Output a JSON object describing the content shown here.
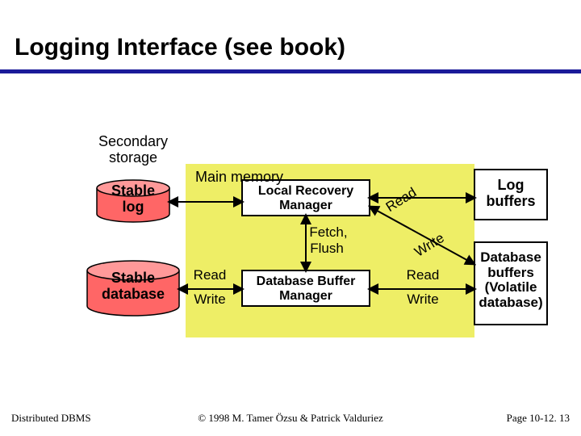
{
  "title": "Logging Interface (see book)",
  "labels": {
    "secondary_storage": "Secondary\nstorage",
    "main_memory": "Main memory",
    "stable_log": "Stable\nlog",
    "stable_db": "Stable\ndatabase",
    "lrm": "Local Recovery\nManager",
    "dbm": "Database Buffer\nManager",
    "fetch": "Fetch,",
    "flush": "Flush",
    "read_l": "Read",
    "write_l": "Write",
    "read_r": "Read",
    "write_r": "Write",
    "read_diag": "Read",
    "write_diag": "Write",
    "log_buffers": "Log\nbuffers",
    "db_buffers": "Database\nbuffers\n(Volatile\ndatabase)"
  },
  "footer": {
    "left": "Distributed DBMS",
    "center": "© 1998 M. Tamer Özsu & Patrick Valduriez",
    "right": "Page 10-12. 13"
  },
  "chart_data": {
    "type": "diagram",
    "title": "Logging Interface",
    "regions": [
      {
        "name": "Secondary storage",
        "contains": [
          "Stable log",
          "Stable database"
        ]
      },
      {
        "name": "Main memory",
        "contains": [
          "Local Recovery Manager",
          "Database Buffer Manager",
          "Log buffers",
          "Database buffers (Volatile database)"
        ]
      }
    ],
    "nodes": [
      {
        "id": "stable_log",
        "label": "Stable log",
        "type": "cylinder",
        "region": "Secondary storage"
      },
      {
        "id": "stable_db",
        "label": "Stable database",
        "type": "cylinder",
        "region": "Secondary storage"
      },
      {
        "id": "lrm",
        "label": "Local Recovery Manager",
        "type": "box",
        "region": "Main memory"
      },
      {
        "id": "dbm",
        "label": "Database Buffer Manager",
        "type": "box",
        "region": "Main memory"
      },
      {
        "id": "log_buf",
        "label": "Log buffers",
        "type": "box",
        "region": "Main memory"
      },
      {
        "id": "db_buf",
        "label": "Database buffers (Volatile database)",
        "type": "box",
        "region": "Main memory"
      }
    ],
    "edges": [
      {
        "from": "stable_log",
        "to": "lrm",
        "bidirectional": true,
        "labels": []
      },
      {
        "from": "stable_db",
        "to": "dbm",
        "bidirectional": true,
        "labels": [
          "Read",
          "Write"
        ]
      },
      {
        "from": "lrm",
        "to": "dbm",
        "bidirectional": true,
        "labels": [
          "Fetch,",
          "Flush"
        ]
      },
      {
        "from": "lrm",
        "to": "log_buf",
        "bidirectional": true,
        "labels": [
          "Read"
        ],
        "diagonal": true
      },
      {
        "from": "lrm",
        "to": "db_buf",
        "bidirectional": true,
        "labels": [
          "Write"
        ],
        "diagonal": true
      },
      {
        "from": "dbm",
        "to": "db_buf",
        "bidirectional": true,
        "labels": [
          "Read",
          "Write"
        ]
      }
    ]
  }
}
